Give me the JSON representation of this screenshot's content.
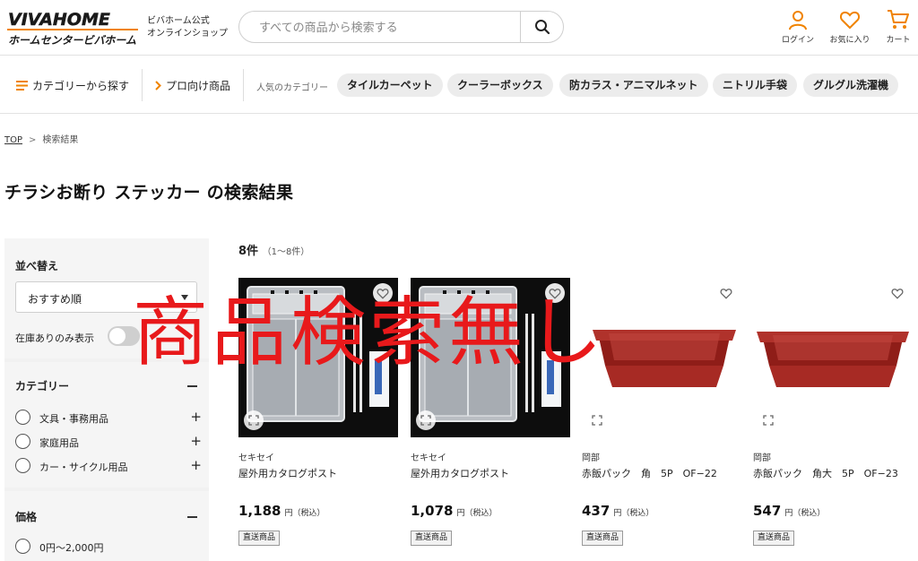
{
  "header": {
    "logo_top": "VIVAHOME",
    "logo_bottom": "ホームセンタービバホーム",
    "logo_sub_line1": "ビバホーム公式",
    "logo_sub_line2": "オンラインショップ",
    "search_placeholder": "すべての商品から検索する",
    "login_label": "ログイン",
    "favorites_label": "お気に入り",
    "cart_label": "カート",
    "accent_color": "#f08300"
  },
  "category_bar": {
    "browse_label": "カテゴリーから探す",
    "pro_label": "プロ向け商品",
    "popular_label": "人気のカテゴリー",
    "pills": [
      "タイルカーペット",
      "クーラーボックス",
      "防カラス・アニマルネット",
      "ニトリル手袋",
      "グルグル洗濯機"
    ]
  },
  "breadcrumb": {
    "top": "TOP",
    "separator": ">",
    "current": "検索結果"
  },
  "page_title": "チラシお断り ステッカー の検索結果",
  "sidebar": {
    "sort_heading": "並べ替え",
    "sort_selected": "おすすめ順",
    "stock_label": "在庫ありのみ表示",
    "category_heading": "カテゴリー",
    "categories": [
      "文具・事務用品",
      "家庭用品",
      "カー・サイクル用品"
    ],
    "price_heading": "価格",
    "price_options": [
      "0円〜2,000円"
    ]
  },
  "results": {
    "count": "8件",
    "range": "（1〜8件）",
    "tax_label": "円（税込）",
    "products": [
      {
        "brand": "セキセイ",
        "name": "屋外用カタログポスト",
        "price": "1,188",
        "tag": "直送商品",
        "image": "clear-catalog-post"
      },
      {
        "brand": "セキセイ",
        "name": "屋外用カタログポスト",
        "price": "1,078",
        "tag": "直送商品",
        "image": "clear-catalog-post"
      },
      {
        "brand": "岡部",
        "name": "赤飯パック　角　5P　OF−22",
        "price": "437",
        "tag": "直送商品",
        "image": "red-rice-pack"
      },
      {
        "brand": "岡部",
        "name": "赤飯パック　角大　5P　OF−23",
        "price": "547",
        "tag": "直送商品",
        "image": "red-rice-pack"
      }
    ]
  },
  "overlay_text": "商品検索無し",
  "overlay_color": "#e8191b"
}
